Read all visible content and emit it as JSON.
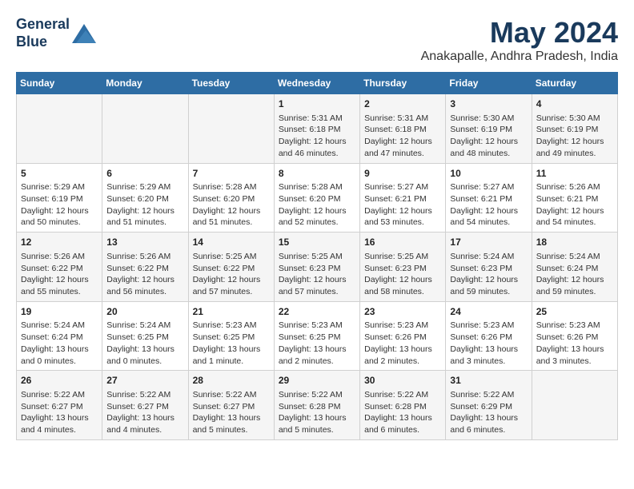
{
  "logo": {
    "line1": "General",
    "line2": "Blue"
  },
  "title": "May 2024",
  "subtitle": "Anakapalle, Andhra Pradesh, India",
  "weekdays": [
    "Sunday",
    "Monday",
    "Tuesday",
    "Wednesday",
    "Thursday",
    "Friday",
    "Saturday"
  ],
  "weeks": [
    [
      {
        "day": "",
        "info": ""
      },
      {
        "day": "",
        "info": ""
      },
      {
        "day": "",
        "info": ""
      },
      {
        "day": "1",
        "info": "Sunrise: 5:31 AM\nSunset: 6:18 PM\nDaylight: 12 hours\nand 46 minutes."
      },
      {
        "day": "2",
        "info": "Sunrise: 5:31 AM\nSunset: 6:18 PM\nDaylight: 12 hours\nand 47 minutes."
      },
      {
        "day": "3",
        "info": "Sunrise: 5:30 AM\nSunset: 6:19 PM\nDaylight: 12 hours\nand 48 minutes."
      },
      {
        "day": "4",
        "info": "Sunrise: 5:30 AM\nSunset: 6:19 PM\nDaylight: 12 hours\nand 49 minutes."
      }
    ],
    [
      {
        "day": "5",
        "info": "Sunrise: 5:29 AM\nSunset: 6:19 PM\nDaylight: 12 hours\nand 50 minutes."
      },
      {
        "day": "6",
        "info": "Sunrise: 5:29 AM\nSunset: 6:20 PM\nDaylight: 12 hours\nand 51 minutes."
      },
      {
        "day": "7",
        "info": "Sunrise: 5:28 AM\nSunset: 6:20 PM\nDaylight: 12 hours\nand 51 minutes."
      },
      {
        "day": "8",
        "info": "Sunrise: 5:28 AM\nSunset: 6:20 PM\nDaylight: 12 hours\nand 52 minutes."
      },
      {
        "day": "9",
        "info": "Sunrise: 5:27 AM\nSunset: 6:21 PM\nDaylight: 12 hours\nand 53 minutes."
      },
      {
        "day": "10",
        "info": "Sunrise: 5:27 AM\nSunset: 6:21 PM\nDaylight: 12 hours\nand 54 minutes."
      },
      {
        "day": "11",
        "info": "Sunrise: 5:26 AM\nSunset: 6:21 PM\nDaylight: 12 hours\nand 54 minutes."
      }
    ],
    [
      {
        "day": "12",
        "info": "Sunrise: 5:26 AM\nSunset: 6:22 PM\nDaylight: 12 hours\nand 55 minutes."
      },
      {
        "day": "13",
        "info": "Sunrise: 5:26 AM\nSunset: 6:22 PM\nDaylight: 12 hours\nand 56 minutes."
      },
      {
        "day": "14",
        "info": "Sunrise: 5:25 AM\nSunset: 6:22 PM\nDaylight: 12 hours\nand 57 minutes."
      },
      {
        "day": "15",
        "info": "Sunrise: 5:25 AM\nSunset: 6:23 PM\nDaylight: 12 hours\nand 57 minutes."
      },
      {
        "day": "16",
        "info": "Sunrise: 5:25 AM\nSunset: 6:23 PM\nDaylight: 12 hours\nand 58 minutes."
      },
      {
        "day": "17",
        "info": "Sunrise: 5:24 AM\nSunset: 6:23 PM\nDaylight: 12 hours\nand 59 minutes."
      },
      {
        "day": "18",
        "info": "Sunrise: 5:24 AM\nSunset: 6:24 PM\nDaylight: 12 hours\nand 59 minutes."
      }
    ],
    [
      {
        "day": "19",
        "info": "Sunrise: 5:24 AM\nSunset: 6:24 PM\nDaylight: 13 hours\nand 0 minutes."
      },
      {
        "day": "20",
        "info": "Sunrise: 5:24 AM\nSunset: 6:25 PM\nDaylight: 13 hours\nand 0 minutes."
      },
      {
        "day": "21",
        "info": "Sunrise: 5:23 AM\nSunset: 6:25 PM\nDaylight: 13 hours\nand 1 minute."
      },
      {
        "day": "22",
        "info": "Sunrise: 5:23 AM\nSunset: 6:25 PM\nDaylight: 13 hours\nand 2 minutes."
      },
      {
        "day": "23",
        "info": "Sunrise: 5:23 AM\nSunset: 6:26 PM\nDaylight: 13 hours\nand 2 minutes."
      },
      {
        "day": "24",
        "info": "Sunrise: 5:23 AM\nSunset: 6:26 PM\nDaylight: 13 hours\nand 3 minutes."
      },
      {
        "day": "25",
        "info": "Sunrise: 5:23 AM\nSunset: 6:26 PM\nDaylight: 13 hours\nand 3 minutes."
      }
    ],
    [
      {
        "day": "26",
        "info": "Sunrise: 5:22 AM\nSunset: 6:27 PM\nDaylight: 13 hours\nand 4 minutes."
      },
      {
        "day": "27",
        "info": "Sunrise: 5:22 AM\nSunset: 6:27 PM\nDaylight: 13 hours\nand 4 minutes."
      },
      {
        "day": "28",
        "info": "Sunrise: 5:22 AM\nSunset: 6:27 PM\nDaylight: 13 hours\nand 5 minutes."
      },
      {
        "day": "29",
        "info": "Sunrise: 5:22 AM\nSunset: 6:28 PM\nDaylight: 13 hours\nand 5 minutes."
      },
      {
        "day": "30",
        "info": "Sunrise: 5:22 AM\nSunset: 6:28 PM\nDaylight: 13 hours\nand 6 minutes."
      },
      {
        "day": "31",
        "info": "Sunrise: 5:22 AM\nSunset: 6:29 PM\nDaylight: 13 hours\nand 6 minutes."
      },
      {
        "day": "",
        "info": ""
      }
    ]
  ]
}
